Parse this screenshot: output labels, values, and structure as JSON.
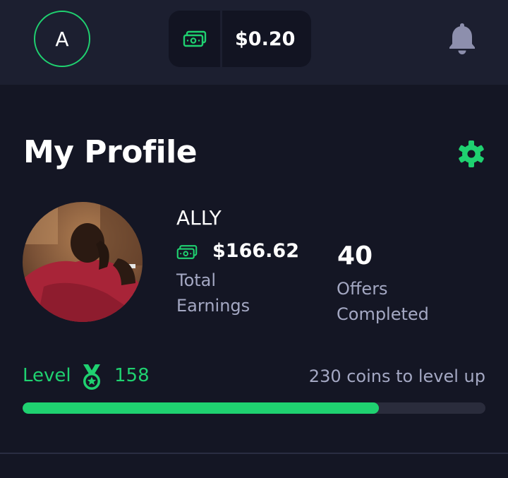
{
  "header": {
    "avatar_letter": "A",
    "balance": "$0.20",
    "balance_icon": "cash-icon",
    "notification_icon": "bell-icon"
  },
  "profile": {
    "title": "My Profile",
    "settings_icon": "gear-icon",
    "username": "ALLY",
    "total_earnings": "$166.62",
    "total_earnings_label": "Total Earnings",
    "offers_completed": "40",
    "offers_completed_label": "Offers Completed"
  },
  "level": {
    "label": "Level",
    "icon": "medal-icon",
    "value": "158",
    "coins_to_level_up": "230 coins to level up",
    "progress_fraction": 0.77
  },
  "colors": {
    "accent": "#1fd170",
    "background": "#141624",
    "header_bg": "#1c1f30",
    "muted_text": "#a4a8c3"
  }
}
